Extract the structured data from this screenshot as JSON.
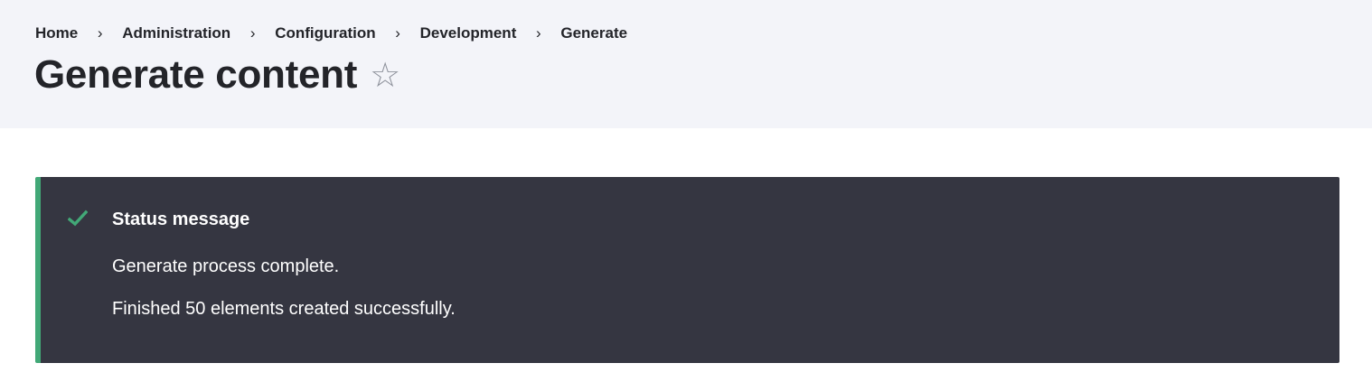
{
  "breadcrumb": {
    "items": [
      {
        "label": "Home"
      },
      {
        "label": "Administration"
      },
      {
        "label": "Configuration"
      },
      {
        "label": "Development"
      },
      {
        "label": "Generate"
      }
    ],
    "separator": "›"
  },
  "page": {
    "title": "Generate content",
    "star_icon": "☆"
  },
  "status": {
    "heading": "Status message",
    "icon": "checkmark-icon",
    "messages": [
      "Generate process complete.",
      "Finished 50 elements created successfully."
    ]
  },
  "colors": {
    "header_bg": "#f3f4f9",
    "status_bg": "#353641",
    "status_accent": "#42a877",
    "text_dark": "#232429",
    "star": "#8e929c"
  }
}
